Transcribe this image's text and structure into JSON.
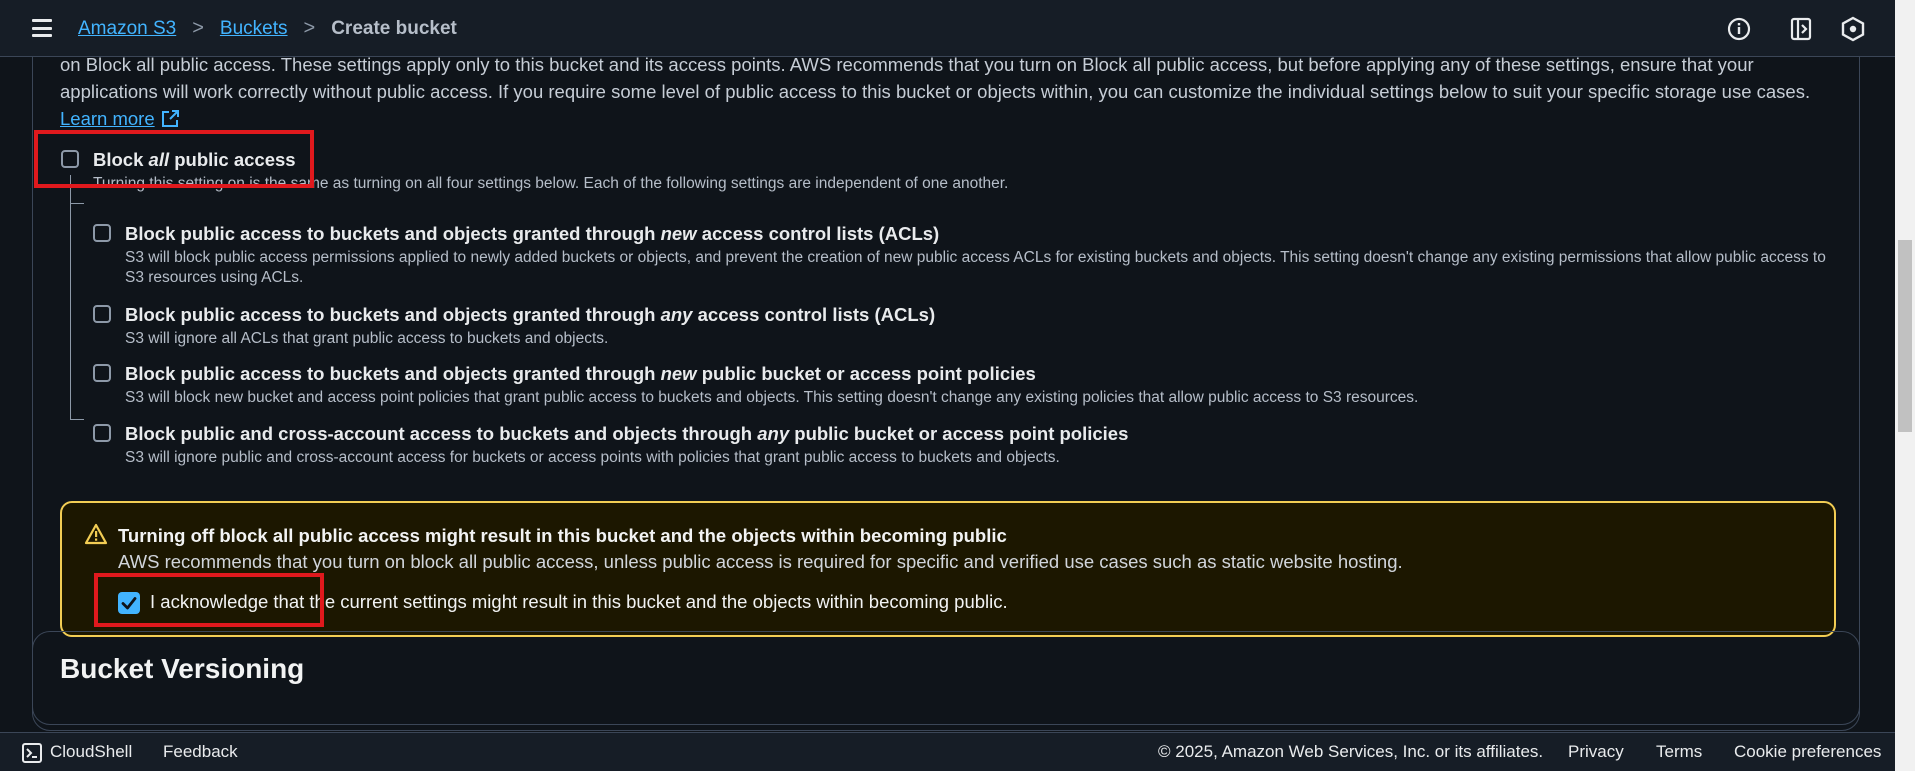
{
  "header": {
    "breadcrumbs": [
      "Amazon S3",
      "Buckets",
      "Create bucket"
    ]
  },
  "intro": {
    "text": "on Block all public access. These settings apply only to this bucket and its access points. AWS recommends that you turn on Block all public access, but before applying any of these settings, ensure that your applications will work correctly without public access. If you require some level of public access to this bucket or objects within, you can customize the individual settings below to suit your specific storage use cases.",
    "learn_more": "Learn more"
  },
  "block_all": {
    "title_pre": "Block ",
    "title_em": "all",
    "title_post": " public access",
    "description": "Turning this setting on is the same as turning on all four settings below. Each of the following settings are independent of one another.",
    "checked": false
  },
  "options": [
    {
      "title_pre": "Block public access to buckets and objects granted through ",
      "title_em": "new",
      "title_post": " access control lists (ACLs)",
      "description": "S3 will block public access permissions applied to newly added buckets or objects, and prevent the creation of new public access ACLs for existing buckets and objects. This setting doesn't change any existing permissions that allow public access to S3 resources using ACLs.",
      "checked": false
    },
    {
      "title_pre": "Block public access to buckets and objects granted through ",
      "title_em": "any",
      "title_post": " access control lists (ACLs)",
      "description": "S3 will ignore all ACLs that grant public access to buckets and objects.",
      "checked": false
    },
    {
      "title_pre": "Block public access to buckets and objects granted through ",
      "title_em": "new",
      "title_post": " public bucket or access point policies",
      "description": "S3 will block new bucket and access point policies that grant public access to buckets and objects. This setting doesn't change any existing policies that allow public access to S3 resources.",
      "checked": false
    },
    {
      "title_pre": "Block public and cross-account access to buckets and objects through ",
      "title_em": "any",
      "title_post": " public bucket or access point policies",
      "description": "S3 will ignore public and cross-account access for buckets or access points with policies that grant public access to buckets and objects.",
      "checked": false
    }
  ],
  "warning": {
    "title": "Turning off block all public access might result in this bucket and the objects within becoming public",
    "text": "AWS recommends that you turn on block all public access, unless public access is required for specific and verified use cases such as static website hosting.",
    "ack_label": "I acknowledge that the current settings might result in this bucket and the objects within becoming public.",
    "ack_checked": true
  },
  "versioning": {
    "title": "Bucket Versioning"
  },
  "footer": {
    "cloudshell": "CloudShell",
    "feedback": "Feedback",
    "copyright": "© 2025, Amazon Web Services, Inc. or its affiliates.",
    "privacy": "Privacy",
    "terms": "Terms",
    "cookie": "Cookie preferences"
  },
  "colors": {
    "background": "#0f141a",
    "link": "#42b4ff",
    "warning_border": "#f2cd54",
    "highlight_box": "#e0191d"
  }
}
